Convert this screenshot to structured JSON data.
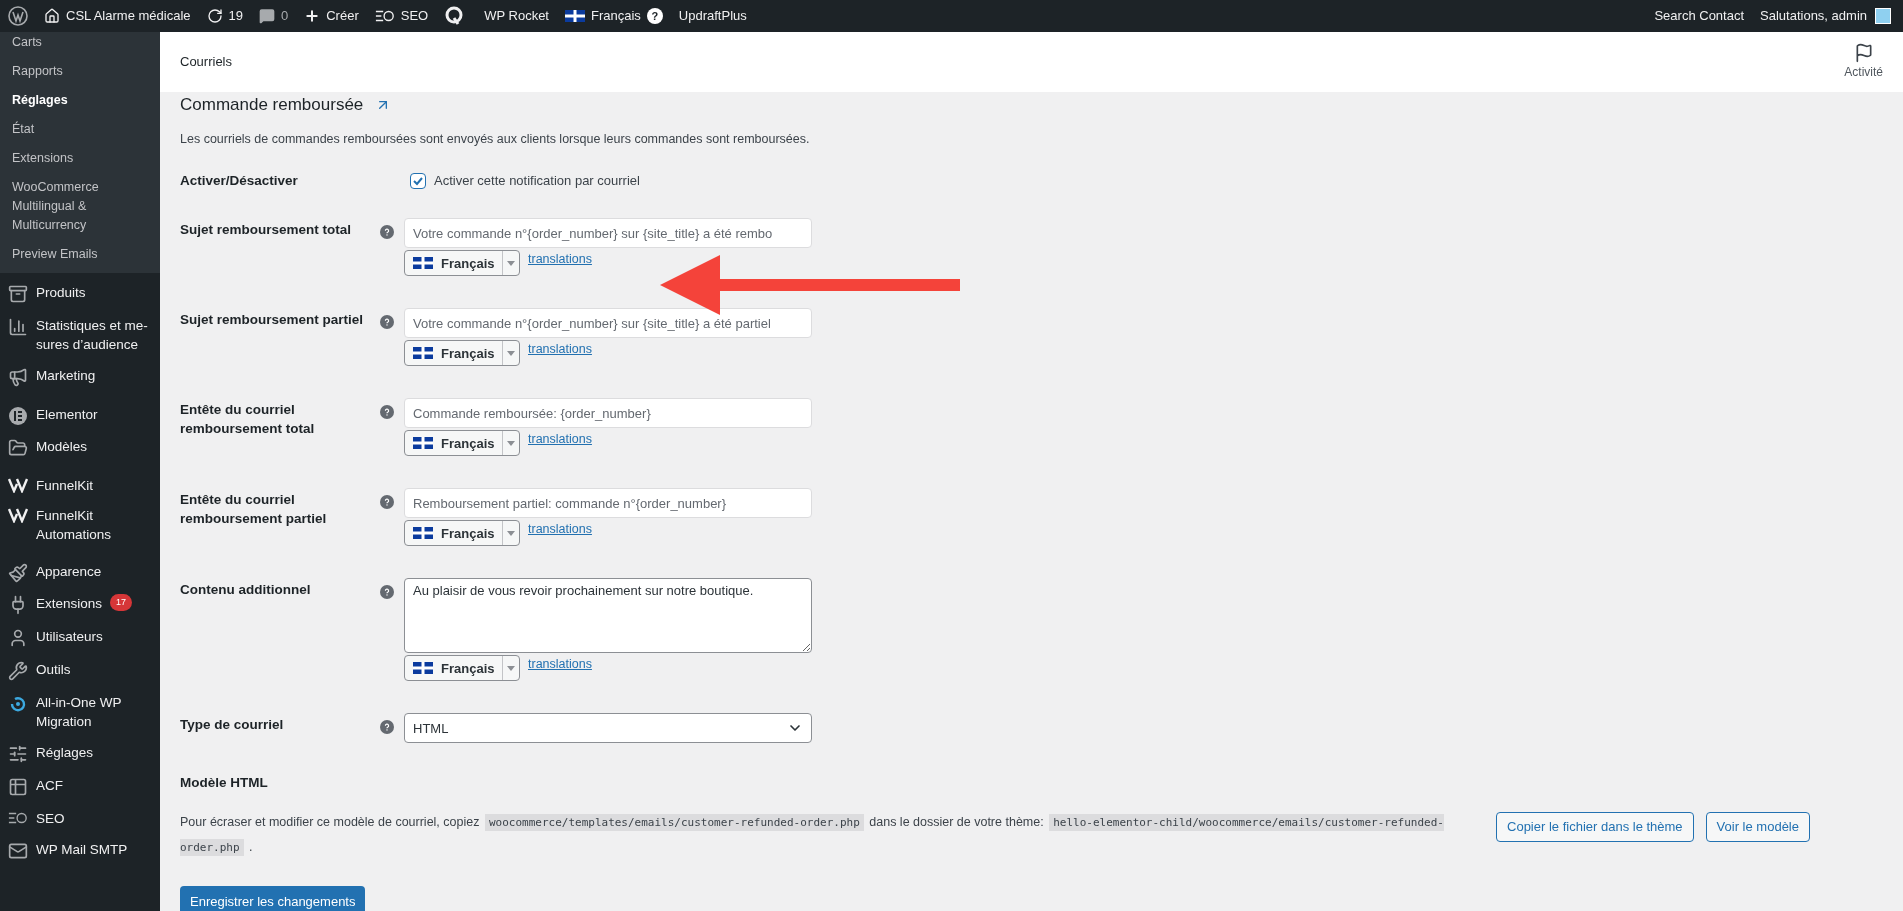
{
  "admin_bar": {
    "left": [
      {
        "text": "CSL Alarme médicale"
      },
      {
        "text": "19"
      },
      {
        "text": "0"
      },
      {
        "text": "Créer"
      },
      {
        "text": "SEO"
      },
      {
        "text": "WP Rocket"
      },
      {
        "text": "Français",
        "help": "?"
      },
      {
        "text": "UpdraftPlus"
      }
    ],
    "right": [
      {
        "text": "Search Contact"
      },
      {
        "text": "Salutations, admin"
      }
    ]
  },
  "sidebar": {
    "submenu": [
      {
        "label": "Carts",
        "selected": false
      },
      {
        "label": "Rapports",
        "selected": false
      },
      {
        "label": "Réglages",
        "selected": true
      },
      {
        "label": "État",
        "selected": false
      },
      {
        "label": "Extensions",
        "selected": false
      },
      {
        "label": "WooCommerce Multilingual & Multicurrency",
        "selected": false
      },
      {
        "label": "Preview Emails",
        "selected": false
      }
    ],
    "items": [
      {
        "label": "Produits"
      },
      {
        "label": "Statistiques et me-sures d’audience"
      },
      {
        "label": "Marketing"
      },
      {
        "label": "Elementor"
      },
      {
        "label": "Modèles"
      },
      {
        "label": "FunnelKit"
      },
      {
        "label": "FunnelKit Automations"
      },
      {
        "label": "Apparence"
      },
      {
        "label": "Extensions",
        "badge": "17"
      },
      {
        "label": "Utilisateurs"
      },
      {
        "label": "Outils"
      },
      {
        "label": "All-in-One WP Migration"
      },
      {
        "label": "Réglages"
      },
      {
        "label": "ACF"
      },
      {
        "label": "SEO"
      },
      {
        "label": "WP Mail SMTP"
      }
    ]
  },
  "header": {
    "title": "Courriels",
    "activity": "Activité"
  },
  "section": {
    "title": "Commande remboursée",
    "description": "Les courriels de commandes remboursées sont envoyés aux clients lorsque leurs commandes sont remboursées."
  },
  "fields": [
    {
      "kind": "checkbox",
      "label": "Activer/Désactiver",
      "text": "Activer cette notification par courriel",
      "checked": true
    },
    {
      "kind": "text",
      "label": "Sujet remboursement total",
      "placeholder": "Votre commande n°{order_number} sur {site_title} a été rembo",
      "language": "Français",
      "link": "translations"
    },
    {
      "kind": "text",
      "label": "Sujet remboursement partiel",
      "placeholder": "Votre commande n°{order_number} sur {site_title} a été partiel",
      "language": "Français",
      "link": "translations"
    },
    {
      "kind": "text",
      "label": "Entête du courriel remboursement total",
      "placeholder": "Commande remboursée: {order_number}",
      "language": "Français",
      "link": "translations"
    },
    {
      "kind": "text",
      "label": "Entête du courriel remboursement partiel",
      "placeholder": "Remboursement partiel: commande n°{order_number}",
      "language": "Français",
      "link": "translations"
    },
    {
      "kind": "textarea",
      "label": "Contenu additionnel",
      "value": "Au plaisir de vous revoir prochainement sur notre boutique.",
      "language": "Français",
      "link": "translations"
    },
    {
      "kind": "select",
      "label": "Type de courriel",
      "value": "HTML"
    }
  ],
  "template": {
    "title": "Modèle HTML",
    "parts": [
      {
        "kind": "text",
        "text": "Pour écraser et modifier ce modèle de courriel, copiez "
      },
      {
        "kind": "code",
        "text": "woocommerce/templates/emails/customer-refunded-order.php"
      },
      {
        "kind": "text",
        "text": " dans le dossier de votre thème: "
      },
      {
        "kind": "code",
        "text": "hello-elementor-child/woocommerce/emails/customer-refunded-order.php"
      },
      {
        "kind": "text",
        "text": " ."
      }
    ],
    "buttons": [
      "Copier le fichier dans le thème",
      "Voir le modèle"
    ]
  },
  "save_button": "Enregistrer les changements"
}
